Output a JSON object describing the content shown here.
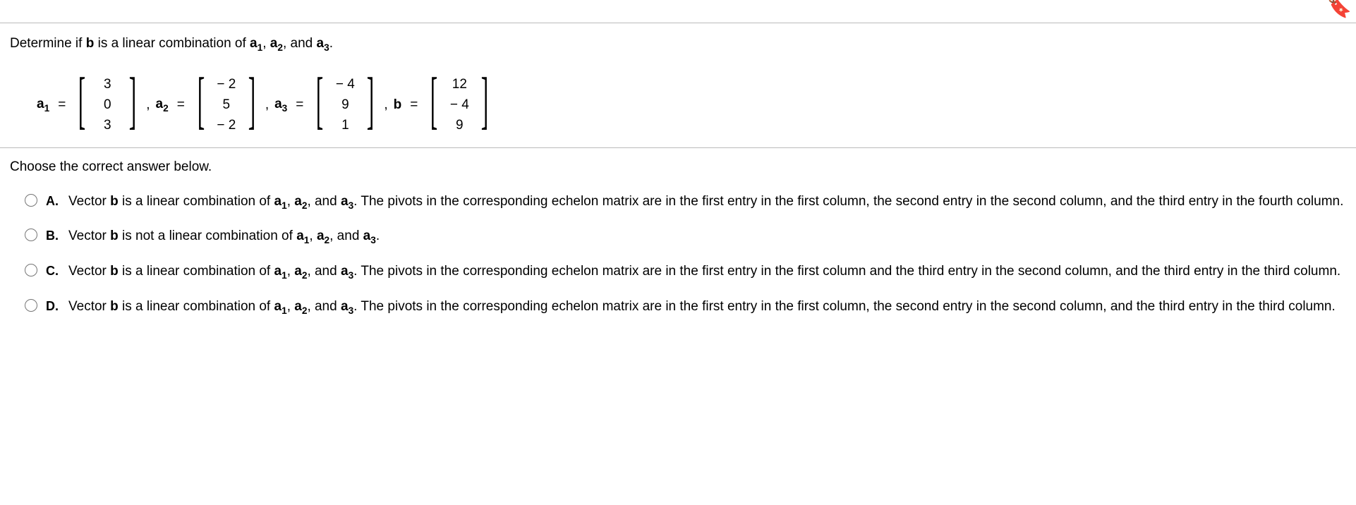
{
  "question": {
    "prompt_pre": "Determine if ",
    "prompt_b": "b",
    "prompt_mid": " is a linear combination of ",
    "a1": "a",
    "s1": "1",
    "c1": ", ",
    "a2": "a",
    "s2": "2",
    "c2": ", and ",
    "a3": "a",
    "s3": "3",
    "dot": "."
  },
  "vectors": {
    "a1_label": "a",
    "a1_sub": "1",
    "eq": "=",
    "a1": [
      "3",
      "0",
      "3"
    ],
    "a2_label": "a",
    "a2_sub": "2",
    "a2": [
      "− 2",
      "5",
      "− 2"
    ],
    "a3_label": "a",
    "a3_sub": "3",
    "a3": [
      "− 4",
      "9",
      "1"
    ],
    "b_label": "b",
    "b": [
      "12",
      "− 4",
      "9"
    ],
    "comma": ","
  },
  "prompt2": "Choose the correct answer below.",
  "choices": {
    "A": {
      "letter": "A.",
      "pre": "Vector ",
      "b": "b",
      "mid": " is a linear combination of ",
      "a1": "a",
      "s1": "1",
      "c1": ", ",
      "a2": "a",
      "s2": "2",
      "c2": ", and ",
      "a3": "a",
      "s3": "3",
      "post": ". The pivots in the corresponding echelon matrix are in the first entry in the first column, the second entry in the second column, and the third entry in the fourth column."
    },
    "B": {
      "letter": "B.",
      "pre": "Vector ",
      "b": "b",
      "mid": " is not a linear combination of ",
      "a1": "a",
      "s1": "1",
      "c1": ", ",
      "a2": "a",
      "s2": "2",
      "c2": ", and ",
      "a3": "a",
      "s3": "3",
      "post": "."
    },
    "C": {
      "letter": "C.",
      "pre": "Vector ",
      "b": "b",
      "mid": " is a linear combination of ",
      "a1": "a",
      "s1": "1",
      "c1": ", ",
      "a2": "a",
      "s2": "2",
      "c2": ", and ",
      "a3": "a",
      "s3": "3",
      "post": ". The pivots in the corresponding echelon matrix are in the first entry in the first column and the third entry in the second column, and the third entry in the third column."
    },
    "D": {
      "letter": "D.",
      "pre": "Vector ",
      "b": "b",
      "mid": " is a linear combination of ",
      "a1": "a",
      "s1": "1",
      "c1": ", ",
      "a2": "a",
      "s2": "2",
      "c2": ", and ",
      "a3": "a",
      "s3": "3",
      "post": ". The pivots in the corresponding echelon matrix are in the first entry in the first column, the second entry in the second column, and the third entry in the third column."
    }
  }
}
